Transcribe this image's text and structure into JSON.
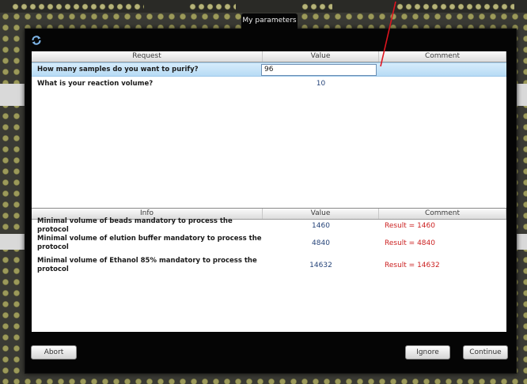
{
  "window": {
    "title": "My parameters"
  },
  "request_table": {
    "headers": [
      "Request",
      "Value",
      "Comment"
    ],
    "rows": [
      {
        "request": "How many samples do you want to purify?",
        "value": "96",
        "comment": ""
      },
      {
        "request": "What is your reaction volume?",
        "value": "10",
        "comment": ""
      }
    ]
  },
  "info_table": {
    "headers": [
      "Info",
      "Value",
      "Comment"
    ],
    "rows": [
      {
        "info": "Minimal volume of beads mandatory to process the protocol",
        "value": "1460",
        "comment": "Result = 1460"
      },
      {
        "info": "Minimal volume of elution buffer mandatory to process the protocol",
        "value": "4840",
        "comment": "Result = 4840"
      },
      {
        "info": "Minimal volume of Ethanol 85% mandatory to process the protocol",
        "value": "14632",
        "comment": "Result = 14632"
      }
    ]
  },
  "buttons": {
    "abort": "Abort",
    "ignore": "Ignore",
    "continue": "Continue"
  },
  "icons": {
    "refresh": "refresh-icon"
  },
  "colors": {
    "selected_row": "#c6e4f8",
    "result_text": "#cc2222",
    "value_text": "#27457a",
    "annotation_arrow": "#e0141e"
  }
}
